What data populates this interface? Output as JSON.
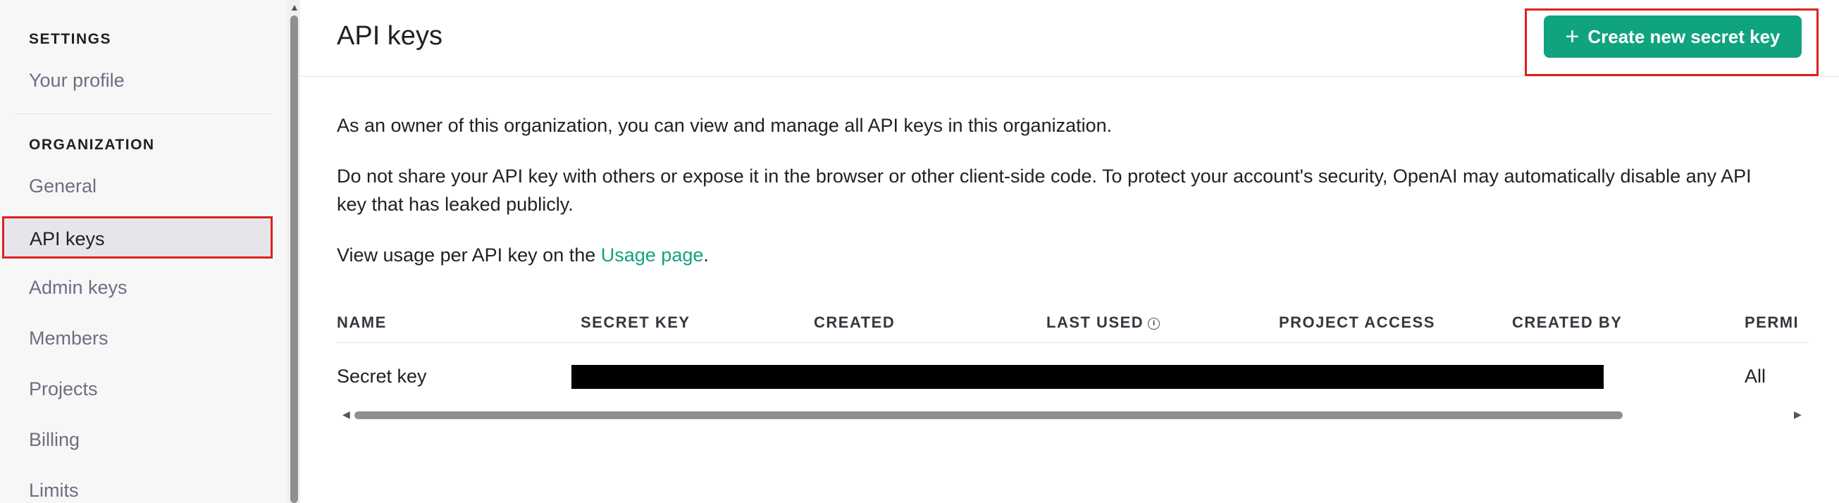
{
  "sidebar": {
    "settings_label": "SETTINGS",
    "settings_items": [
      "Your profile"
    ],
    "organization_label": "ORGANIZATION",
    "items": [
      "General",
      "API keys",
      "Admin keys",
      "Members",
      "Projects",
      "Billing",
      "Limits"
    ],
    "active": "API keys"
  },
  "header": {
    "title": "API keys",
    "create_button": "Create new secret key",
    "create_icon": "+"
  },
  "content": {
    "para1": "As an owner of this organization, you can view and manage all API keys in this organization.",
    "para2_line1": "Do not share your API key with others or expose it in the browser or other client-side code. To protect your account's security, OpenAI may automatically disable any API",
    "para2_line2": "key that has leaked publicly.",
    "para3_prefix": "View usage per API key on the ",
    "para3_link": "Usage page",
    "para3_suffix": "."
  },
  "table": {
    "columns": [
      "NAME",
      "SECRET KEY",
      "CREATED",
      "LAST USED",
      "PROJECT ACCESS",
      "CREATED BY",
      "PERMI"
    ],
    "rows": [
      {
        "name": "Secret key",
        "permissions": "All"
      }
    ]
  },
  "colors": {
    "accent": "#10a37f",
    "highlight": "#e02020"
  }
}
